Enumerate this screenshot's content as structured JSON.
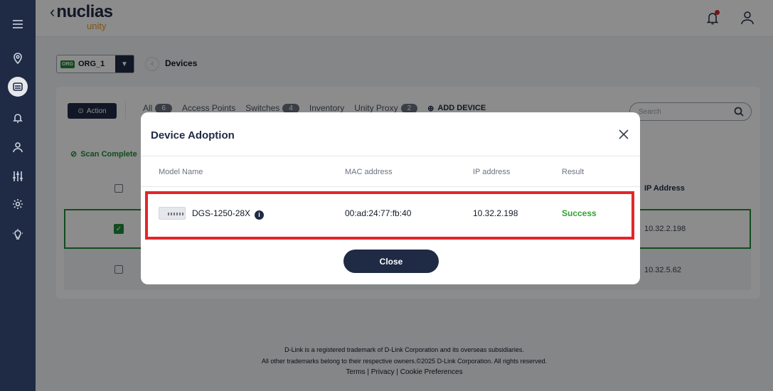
{
  "header": {
    "logo_main": "nuclias",
    "logo_sub": "unity"
  },
  "org": {
    "badge": "ORG",
    "name": "ORG_1"
  },
  "page_title": "Devices",
  "toolbar": {
    "action_label": "Action",
    "tabs": [
      {
        "label": "All",
        "count": "6"
      },
      {
        "label": "Access Points",
        "count": ""
      },
      {
        "label": "Switches",
        "count": "4"
      },
      {
        "label": "Inventory",
        "count": ""
      },
      {
        "label": "Unity Proxy",
        "count": "2"
      }
    ],
    "add_device_label": "ADD DEVICE",
    "search_placeholder": "Search"
  },
  "scan_status": "Scan Complete",
  "table": {
    "ip_header": "IP Address",
    "rows": [
      {
        "ip": "10.32.2.198",
        "selected": true
      },
      {
        "ip": "10.32.5.62",
        "selected": false
      }
    ]
  },
  "modal": {
    "title": "Device Adoption",
    "columns": {
      "model": "Model Name",
      "mac": "MAC address",
      "ip": "IP address",
      "result": "Result"
    },
    "row": {
      "model": "DGS-1250-28X",
      "mac": "00:ad:24:77:fb:40",
      "ip": "10.32.2.198",
      "result": "Success"
    },
    "close_label": "Close"
  },
  "footer": {
    "line1": "D-Link is a registered trademark of D-Link Corporation and its overseas subsidiaries.",
    "line2": "All other trademarks belong to their respective owners.©2025 D-Link Corporation. All rights reserved.",
    "links": [
      "Terms",
      "Privacy",
      "Cookie Preferences"
    ],
    "separator": "|"
  },
  "colors": {
    "navy": "#1f2a44",
    "green": "#1f8a3a",
    "success": "#2fa32f",
    "highlight": "#e3262b",
    "accent_orange": "#e39a2d"
  },
  "icons": [
    "menu-icon",
    "location-icon",
    "devices-icon",
    "bell-icon",
    "user-icon",
    "sliders-icon",
    "gear-icon",
    "bulb-icon",
    "search-icon",
    "close-icon",
    "info-icon",
    "check-circle-icon",
    "plus-circle-icon"
  ]
}
